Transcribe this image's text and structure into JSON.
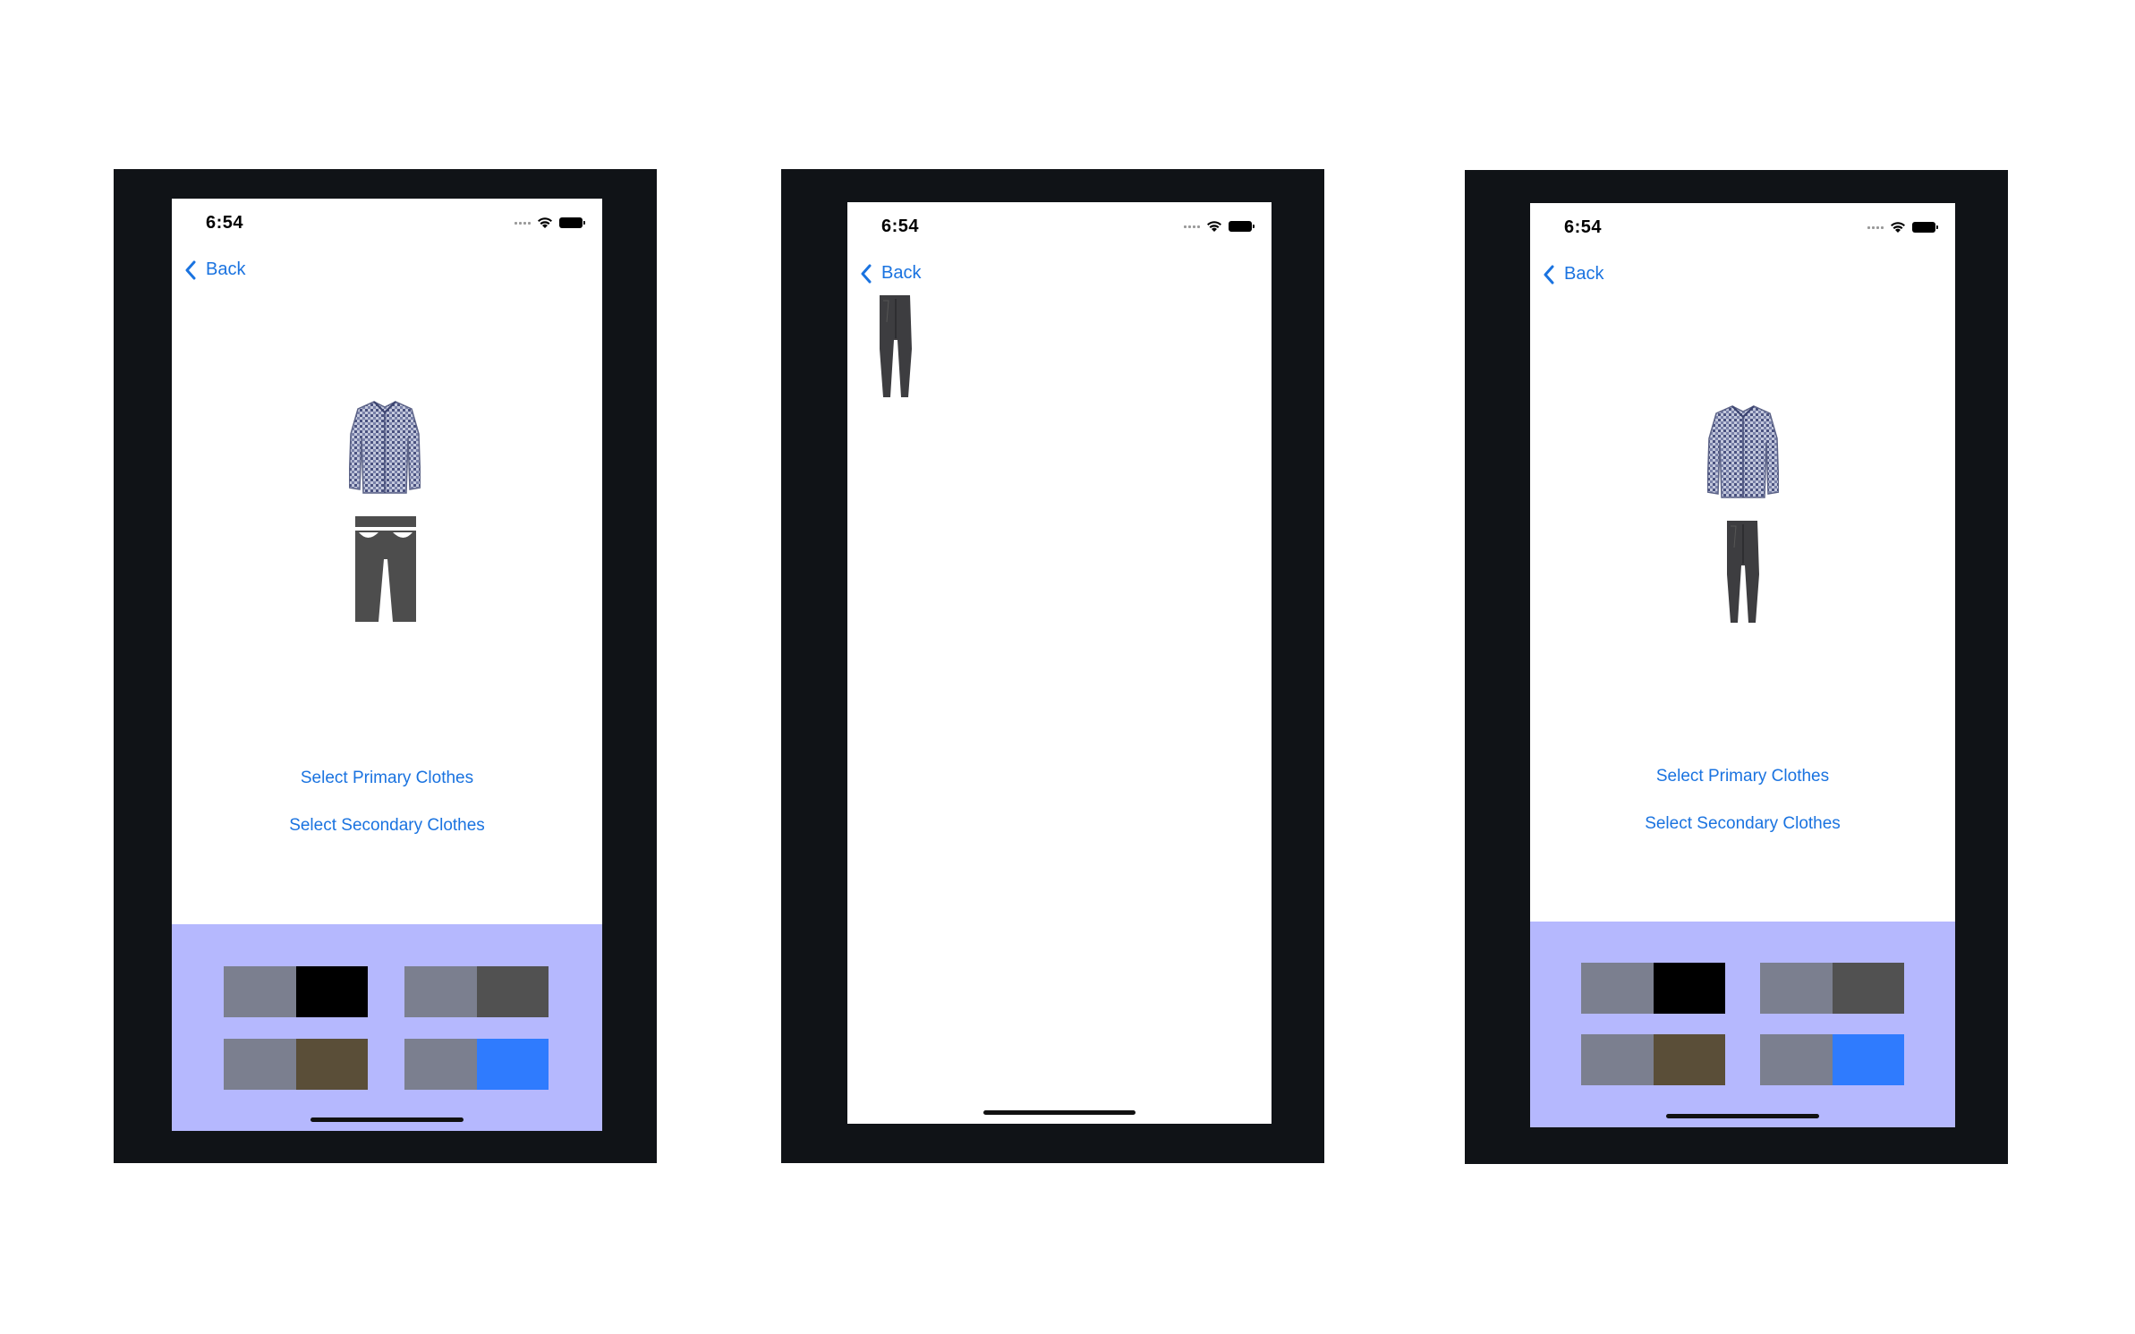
{
  "status_time": "6:54",
  "back_label": "Back",
  "select_primary_label": "Select Primary Clothes",
  "select_secondary_label": "Select Secondary Clothes",
  "colors": {
    "link": "#1a73e0",
    "panel": "#b5b8fe",
    "frame": "#101317",
    "primary_swatch_gray": "#7b7f8f"
  },
  "color_options": [
    {
      "primary": "#7b7f8f",
      "secondary": "#000000"
    },
    {
      "primary": "#7b7f8f",
      "secondary": "#515151"
    },
    {
      "primary": "#7b7f8f",
      "secondary": "#5a4e38"
    },
    {
      "primary": "#7b7f8f",
      "secondary": "#2f7bfe"
    }
  ],
  "icons": [
    "back-chevron-icon",
    "wifi-icon",
    "battery-icon",
    "signal-dots-icon",
    "shirt-icon",
    "pants-icon"
  ]
}
